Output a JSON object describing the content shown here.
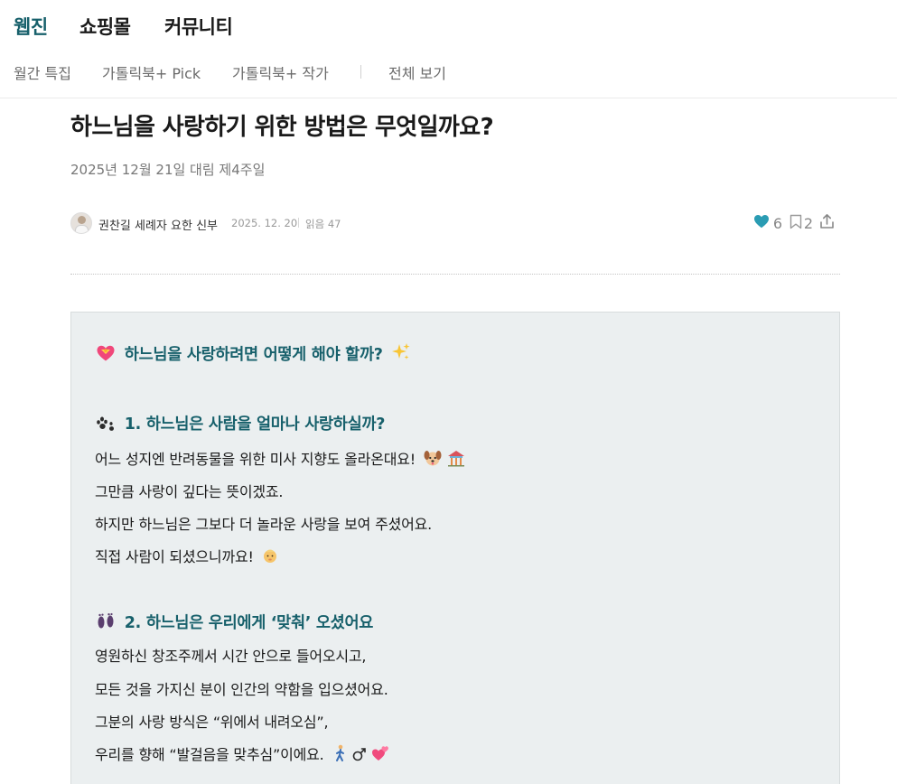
{
  "top_tabs": [
    {
      "label": "웹진",
      "active": true
    },
    {
      "label": "쇼핑몰",
      "active": false
    },
    {
      "label": "커뮤니티",
      "active": false
    }
  ],
  "sub_nav": [
    "월간 특집",
    "가톨릭북+ Pick",
    "가톨릭북+ 작가",
    "전체 보기"
  ],
  "article": {
    "title": "하느님을 사랑하기 위한 방법은 무엇일까요?",
    "subtitle": "2025년 12월 21일 대림 제4주일",
    "author": "권찬길 세례자 요한 신부",
    "date": "2025. 12. 20",
    "reads": "읽음 47",
    "likes": "6",
    "bookmarks": "2"
  },
  "content": {
    "heading_main": "하느님을 사랑하려면 어떻게 해야 할까?",
    "section1_heading": "1. 하느님은 사람을 얼마나 사랑하실까?",
    "section1_lines": [
      "어느 성지엔 반려동물을 위한 미사 지향도 올라온대요!",
      "그만큼 사랑이 깊다는 뜻이겠죠.",
      "하지만 하느님은 그보다 더 놀라운 사랑을 보여 주셨어요.",
      "직접 사람이 되셨으니까요!"
    ],
    "section2_heading": "2. 하느님은 우리에게 ‘맞춰’ 오셨어요",
    "section2_lines": [
      "영원하신 창조주께서 시간 안으로 들어오시고,",
      "모든 것을 가지신 분이 인간의 약함을 입으셨어요.",
      "그분의 사랑 방식은 “위에서 내려오심”,",
      "우리를 향해 “발걸음을 맞추심”이에요."
    ],
    "icons": [
      "heart-ribbon-icon",
      "sparkles-icon",
      "paw-prints-icon",
      "dog-face-icon",
      "temple-icon",
      "baby-icon",
      "footprints-icon",
      "walking-person-icon",
      "male-sign-icon",
      "two-hearts-icon"
    ]
  },
  "colors": {
    "accent": "#17606b",
    "like_heart": "#2a9cb3",
    "card_bg": "#ebeff0"
  }
}
